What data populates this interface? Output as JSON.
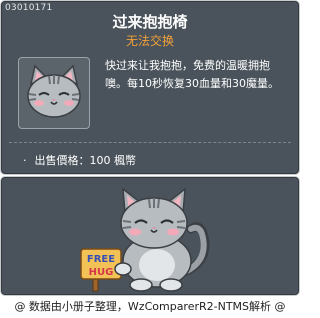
{
  "item": {
    "id": "03010171",
    "name": "过来抱抱椅",
    "trade_status": "无法交换",
    "description": "快过来让我抱抱，免费的温暖拥抱噢。每10秒恢复30血量和30魔量。",
    "price_label": "出售價格：100 楓幣"
  },
  "preview": {
    "sign_text_line1": "FREE",
    "sign_text_line2": "HUG"
  },
  "footer": {
    "text": "@ 数据由小册子整理，WzComparerR2-NTMS解析 @"
  },
  "colors": {
    "panel_bg": "#4a535b",
    "trade_status": "#f2a13a",
    "cat_grey": "#8f969c"
  }
}
